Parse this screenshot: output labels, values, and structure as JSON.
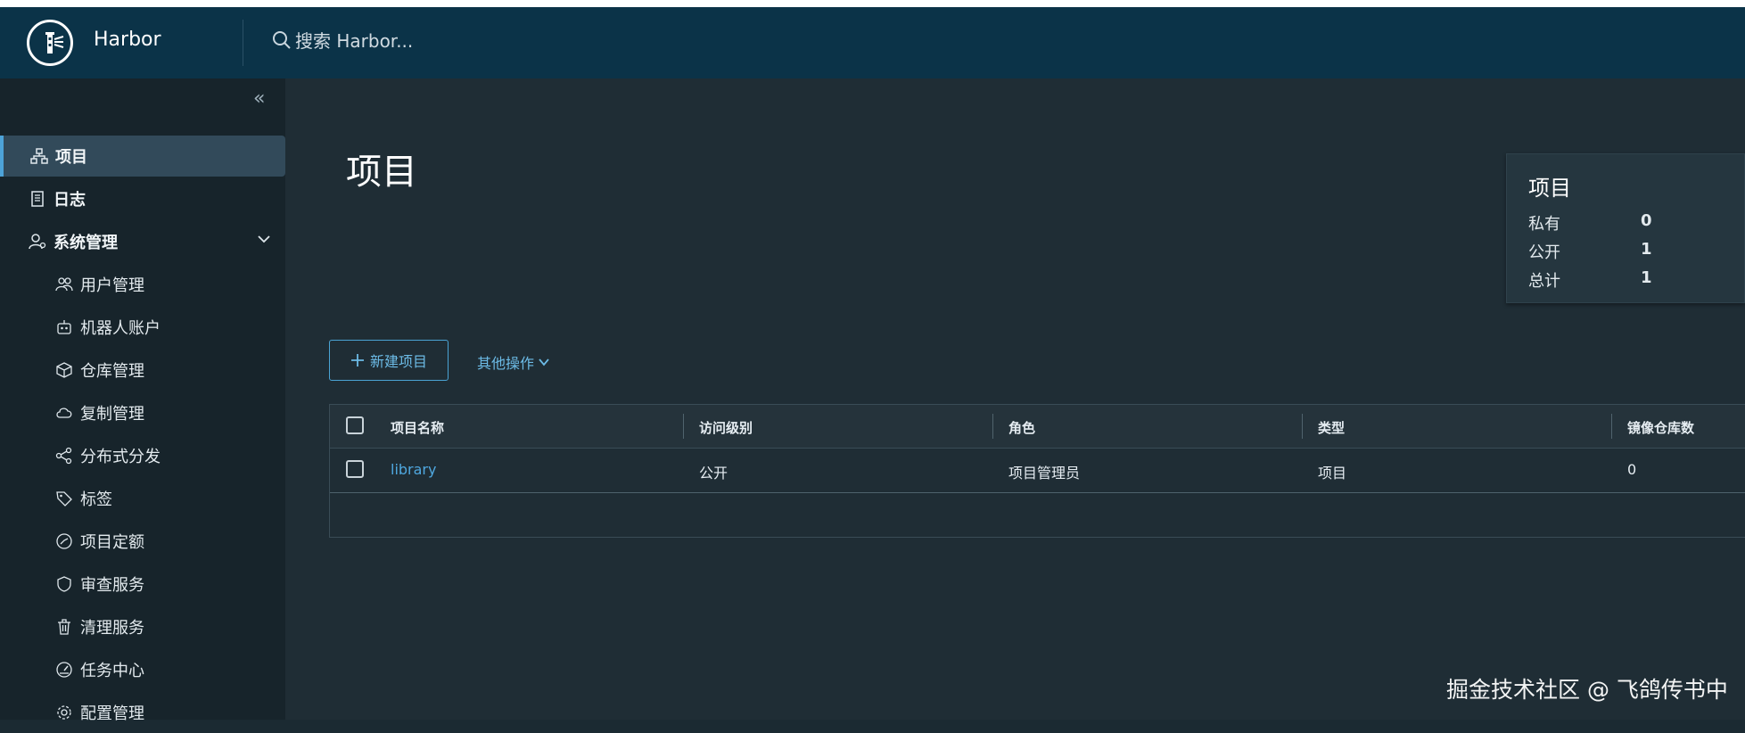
{
  "header": {
    "brand": "Harbor",
    "search_placeholder": "搜索 Harbor..."
  },
  "sidebar": {
    "items": [
      {
        "label": "项目",
        "icon": "projects-icon",
        "active": true
      },
      {
        "label": "日志",
        "icon": "logs-icon"
      },
      {
        "label": "系统管理",
        "icon": "admin-icon",
        "expanded": true
      },
      {
        "label": "用户管理",
        "icon": "users-icon"
      },
      {
        "label": "机器人账户",
        "icon": "robot-icon"
      },
      {
        "label": "仓库管理",
        "icon": "registry-icon"
      },
      {
        "label": "复制管理",
        "icon": "replication-icon"
      },
      {
        "label": "分布式分发",
        "icon": "share-icon"
      },
      {
        "label": "标签",
        "icon": "tag-icon"
      },
      {
        "label": "项目定额",
        "icon": "quota-icon"
      },
      {
        "label": "审查服务",
        "icon": "shield-icon"
      },
      {
        "label": "清理服务",
        "icon": "trash-icon"
      },
      {
        "label": "任务中心",
        "icon": "dashboard-icon"
      },
      {
        "label": "配置管理",
        "icon": "gear-icon"
      }
    ]
  },
  "main": {
    "title": "项目",
    "summary": {
      "title": "项目",
      "rows": [
        {
          "label": "私有",
          "value": "0"
        },
        {
          "label": "公开",
          "value": "1"
        },
        {
          "label": "总计",
          "value": "1"
        }
      ]
    },
    "new_project_label": "新建项目",
    "more_actions_label": "其他操作",
    "table": {
      "columns": [
        "项目名称",
        "访问级别",
        "角色",
        "类型",
        "镜像仓库数"
      ],
      "rows": [
        [
          "library",
          "公开",
          "项目管理员",
          "项目",
          "0"
        ]
      ]
    }
  },
  "watermark": "掘金技术社区 @ 飞鸽传书中",
  "colors": {
    "header": "#0b3348",
    "accent": "#4fa8e0",
    "sidebar": "#17242b",
    "main": "#1f2d35"
  }
}
